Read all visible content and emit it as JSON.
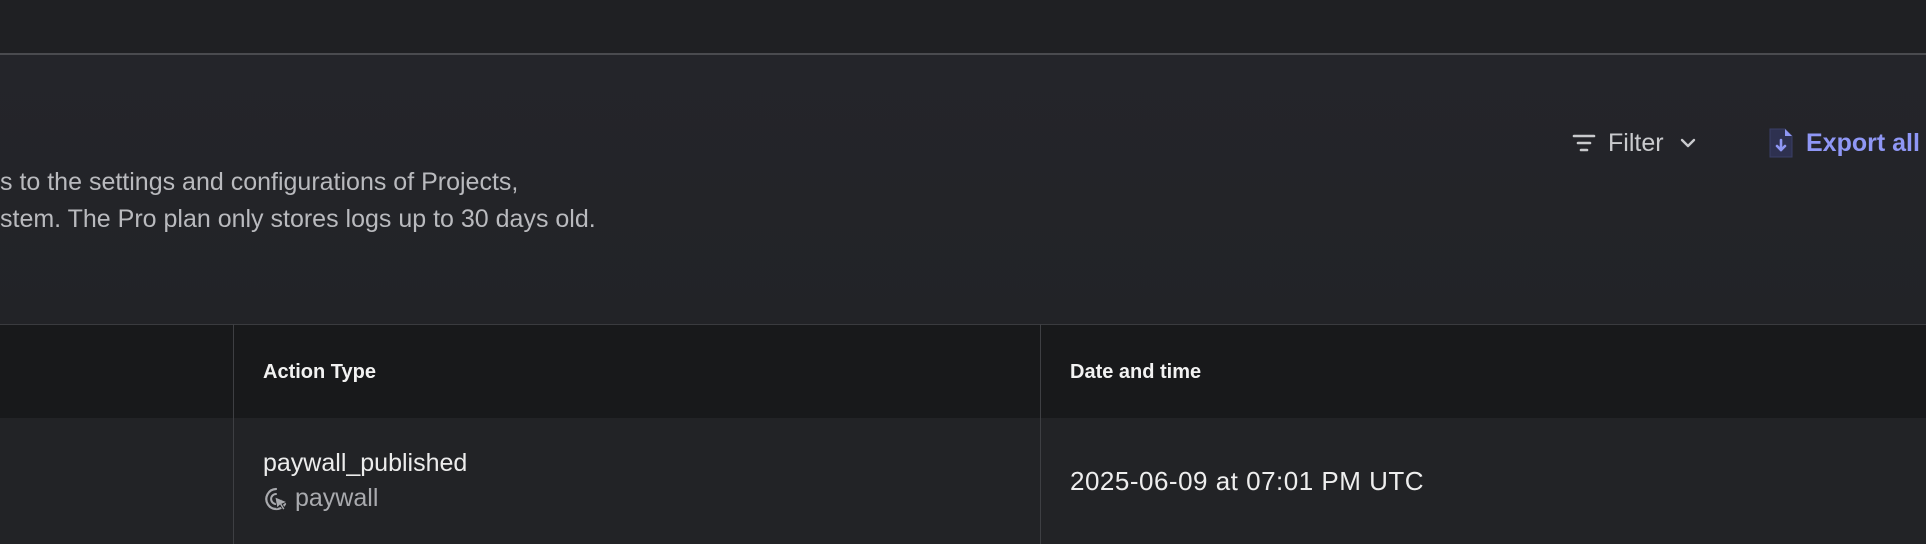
{
  "description": {
    "line1": "s to the settings and configurations of Projects,",
    "line2": "stem. The Pro plan only stores logs up to 30 days old."
  },
  "toolbar": {
    "filter_label": "Filter",
    "filter_icon": "filter-lines-icon",
    "filter_chevron_icon": "chevron-down-icon",
    "export_label": "Export all",
    "export_icon": "file-download-icon",
    "export_color": "#8f97f5"
  },
  "table": {
    "headers": [
      "Action Type",
      "Date and time"
    ],
    "rows": [
      {
        "action_type": "paywall_published",
        "entity_label": "paywall",
        "entity_icon": "paywall-cursor-icon",
        "date_time": "2025-06-09 at 07:01 PM UTC"
      }
    ]
  }
}
